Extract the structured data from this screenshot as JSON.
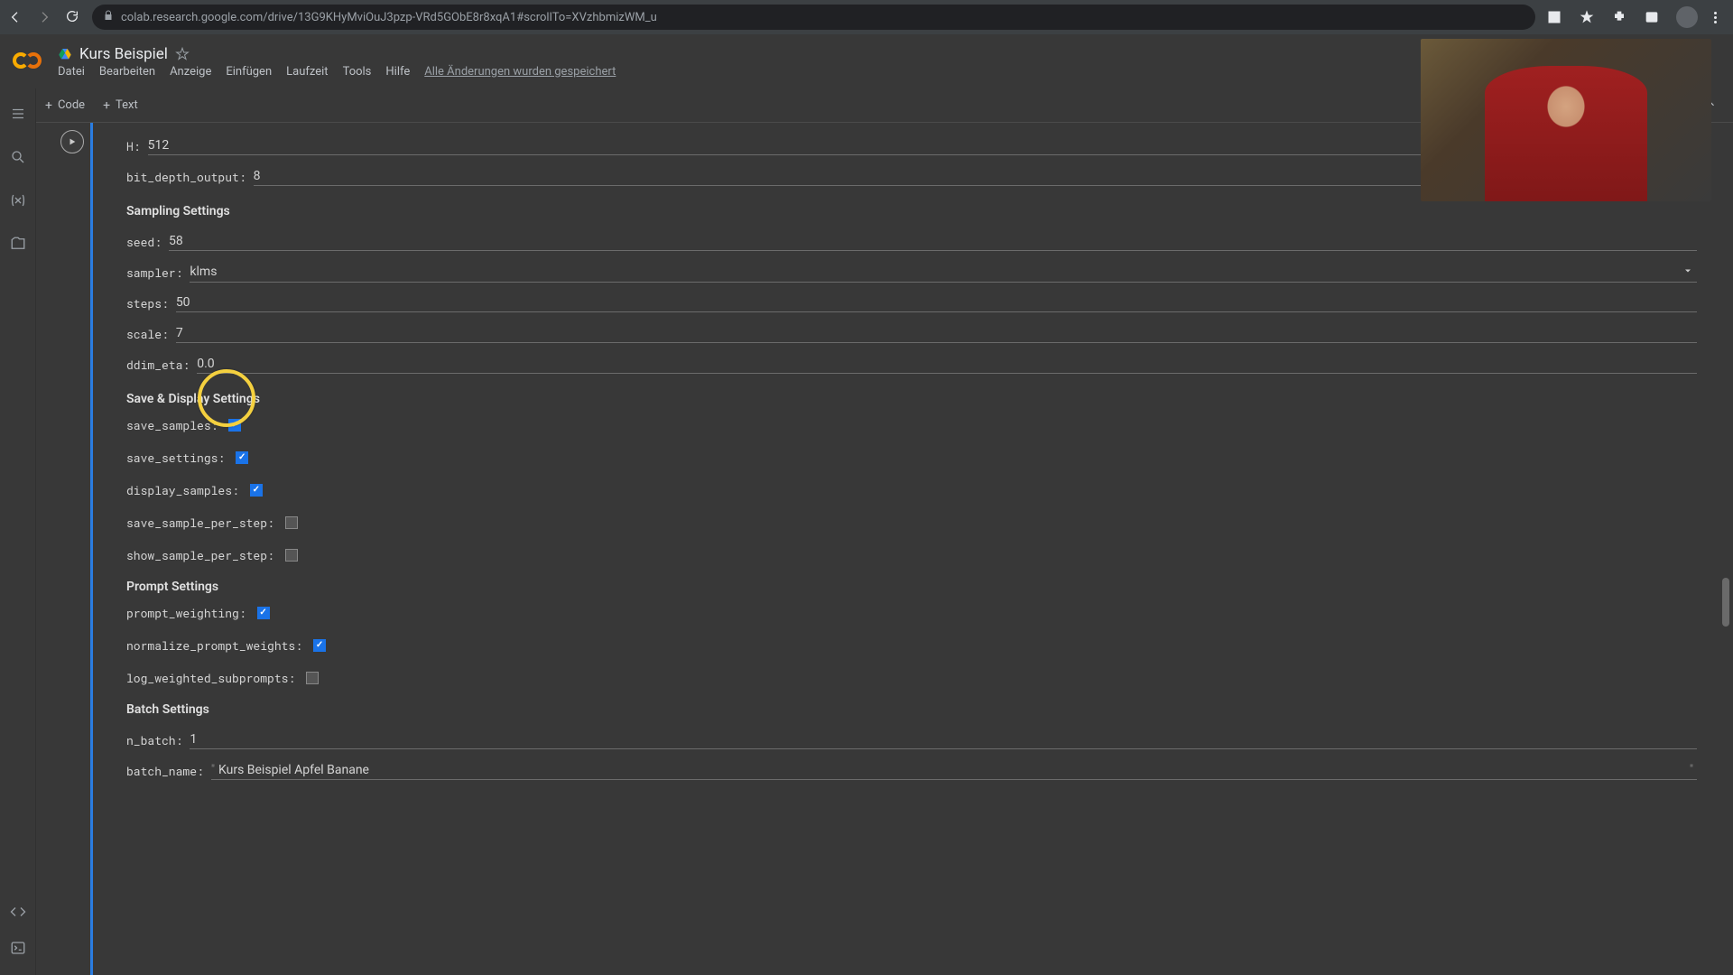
{
  "browser": {
    "url": "colab.research.google.com/drive/13G9KHyMviOuJ3pzp-VRd5GObE8r8xqA1#scrollTo=XVzhbmizWM_u"
  },
  "doc": {
    "title": "Kurs Beispiel"
  },
  "menu": {
    "file": "Datei",
    "edit": "Bearbeiten",
    "view": "Anzeige",
    "insert": "Einfügen",
    "runtime": "Laufzeit",
    "tools": "Tools",
    "help": "Hilfe",
    "saved": "Alle Änderungen wurden gespeichert"
  },
  "toolbar": {
    "code": "Code",
    "text": "Text"
  },
  "params": {
    "H_label": "H:",
    "H": "512",
    "bit_depth_label": "bit_depth_output:",
    "bit_depth": "8"
  },
  "sampling": {
    "title": "Sampling Settings",
    "seed_label": "seed:",
    "seed": "58",
    "sampler_label": "sampler:",
    "sampler": "klms",
    "steps_label": "steps:",
    "steps": "50",
    "scale_label": "scale:",
    "scale": "7",
    "ddim_eta_label": "ddim_eta:",
    "ddim_eta": "0.0"
  },
  "save_display": {
    "title": "Save & Display Settings",
    "save_samples_label": "save_samples:",
    "save_settings_label": "save_settings:",
    "display_samples_label": "display_samples:",
    "save_sample_per_step_label": "save_sample_per_step:",
    "show_sample_per_step_label": "show_sample_per_step:"
  },
  "prompt": {
    "title": "Prompt Settings",
    "prompt_weighting_label": "prompt_weighting:",
    "normalize_prompt_weights_label": "normalize_prompt_weights:",
    "log_weighted_subprompts_label": "log_weighted_subprompts:"
  },
  "batch": {
    "title": "Batch Settings",
    "n_batch_label": "n_batch:",
    "n_batch": "1",
    "batch_name_label": "batch_name:",
    "batch_name": "Kurs Beispiel Apfel Banane"
  }
}
